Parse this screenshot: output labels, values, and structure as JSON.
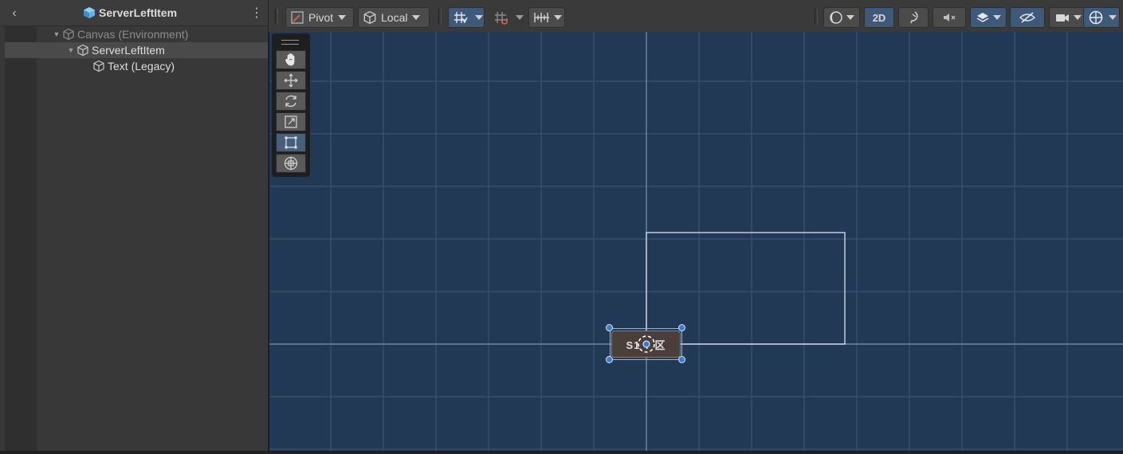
{
  "hierarchy": {
    "title": "ServerLeftItem",
    "items": [
      {
        "label": "Canvas (Environment)",
        "expanded": true,
        "dimmed": true
      },
      {
        "label": "ServerLeftItem",
        "expanded": true,
        "selected": true
      },
      {
        "label": "Text (Legacy)"
      }
    ]
  },
  "toolbar": {
    "pivot_label": "Pivot",
    "local_label": "Local",
    "mode_2d_label": "2D"
  },
  "scene": {
    "item_text": "S1 ? 区",
    "icons": [
      "hand-tool-icon",
      "move-tool-icon",
      "rotate-tool-icon",
      "scale-tool-icon",
      "rect-tool-icon",
      "transform-tool-icon"
    ],
    "active_tool": "rect-tool-icon"
  },
  "colors": {
    "scene_background": "#223955",
    "grid_line": "#4a6383",
    "accent": "#3d5a7a",
    "handle": "#3a7bd5"
  }
}
